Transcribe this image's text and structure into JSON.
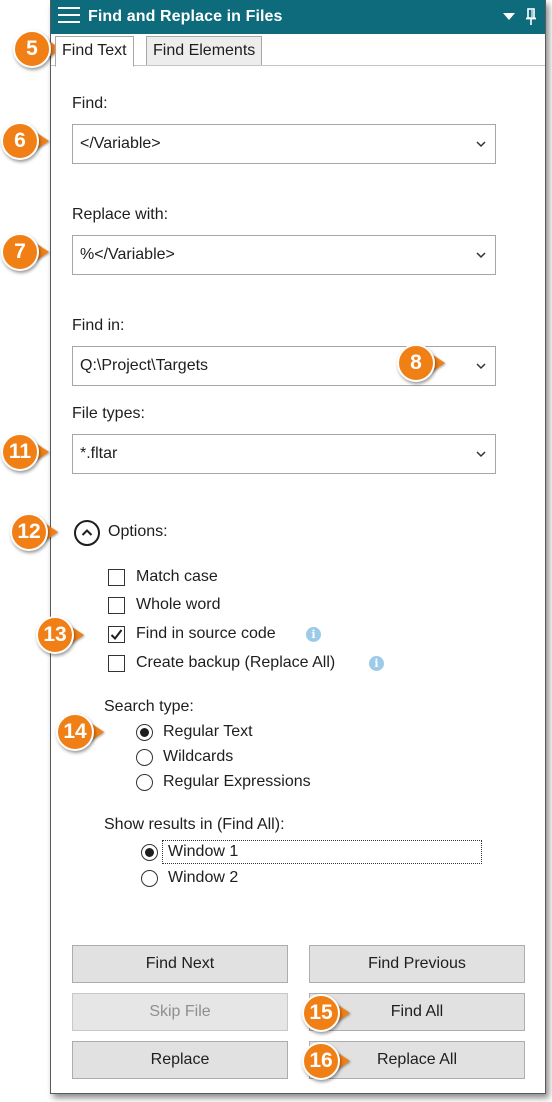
{
  "window": {
    "title": "Find and Replace in Files"
  },
  "tabs": [
    {
      "label": "Find Text"
    },
    {
      "label": "Find Elements"
    }
  ],
  "find": {
    "label": "Find:",
    "value": "</Variable>"
  },
  "replace": {
    "label": "Replace with:",
    "value": "%</Variable>"
  },
  "find_in": {
    "label": "Find in:",
    "value": "Q:\\Project\\Targets"
  },
  "file_types": {
    "label": "File types:",
    "value": "*.fltar"
  },
  "options": {
    "label": "Options:",
    "checkboxes": [
      {
        "label": "Match case",
        "checked": false
      },
      {
        "label": "Whole word",
        "checked": false
      },
      {
        "label": "Find in source code",
        "checked": true
      },
      {
        "label": "Create backup (Replace All)",
        "checked": false
      }
    ],
    "info_icon": "i"
  },
  "search_type": {
    "label": "Search type:",
    "choices": [
      {
        "label": "Regular Text",
        "selected": true
      },
      {
        "label": "Wildcards",
        "selected": false
      },
      {
        "label": "Regular Expressions",
        "selected": false
      }
    ]
  },
  "show_results": {
    "label": "Show results in (Find All):",
    "choices": [
      {
        "label": "Window 1",
        "selected": true
      },
      {
        "label": "Window 2",
        "selected": false
      }
    ]
  },
  "buttons": {
    "find_next": "Find Next",
    "find_previous": "Find Previous",
    "skip_file": "Skip File",
    "find_all": "Find All",
    "replace": "Replace",
    "replace_all": "Replace All"
  },
  "callouts": [
    "5",
    "6",
    "7",
    "8",
    "11",
    "12",
    "13",
    "14",
    "15",
    "16"
  ],
  "colors": {
    "titlebar": "#0e6b7c",
    "callout": "#f07f16",
    "info": "#9ccbe9"
  }
}
